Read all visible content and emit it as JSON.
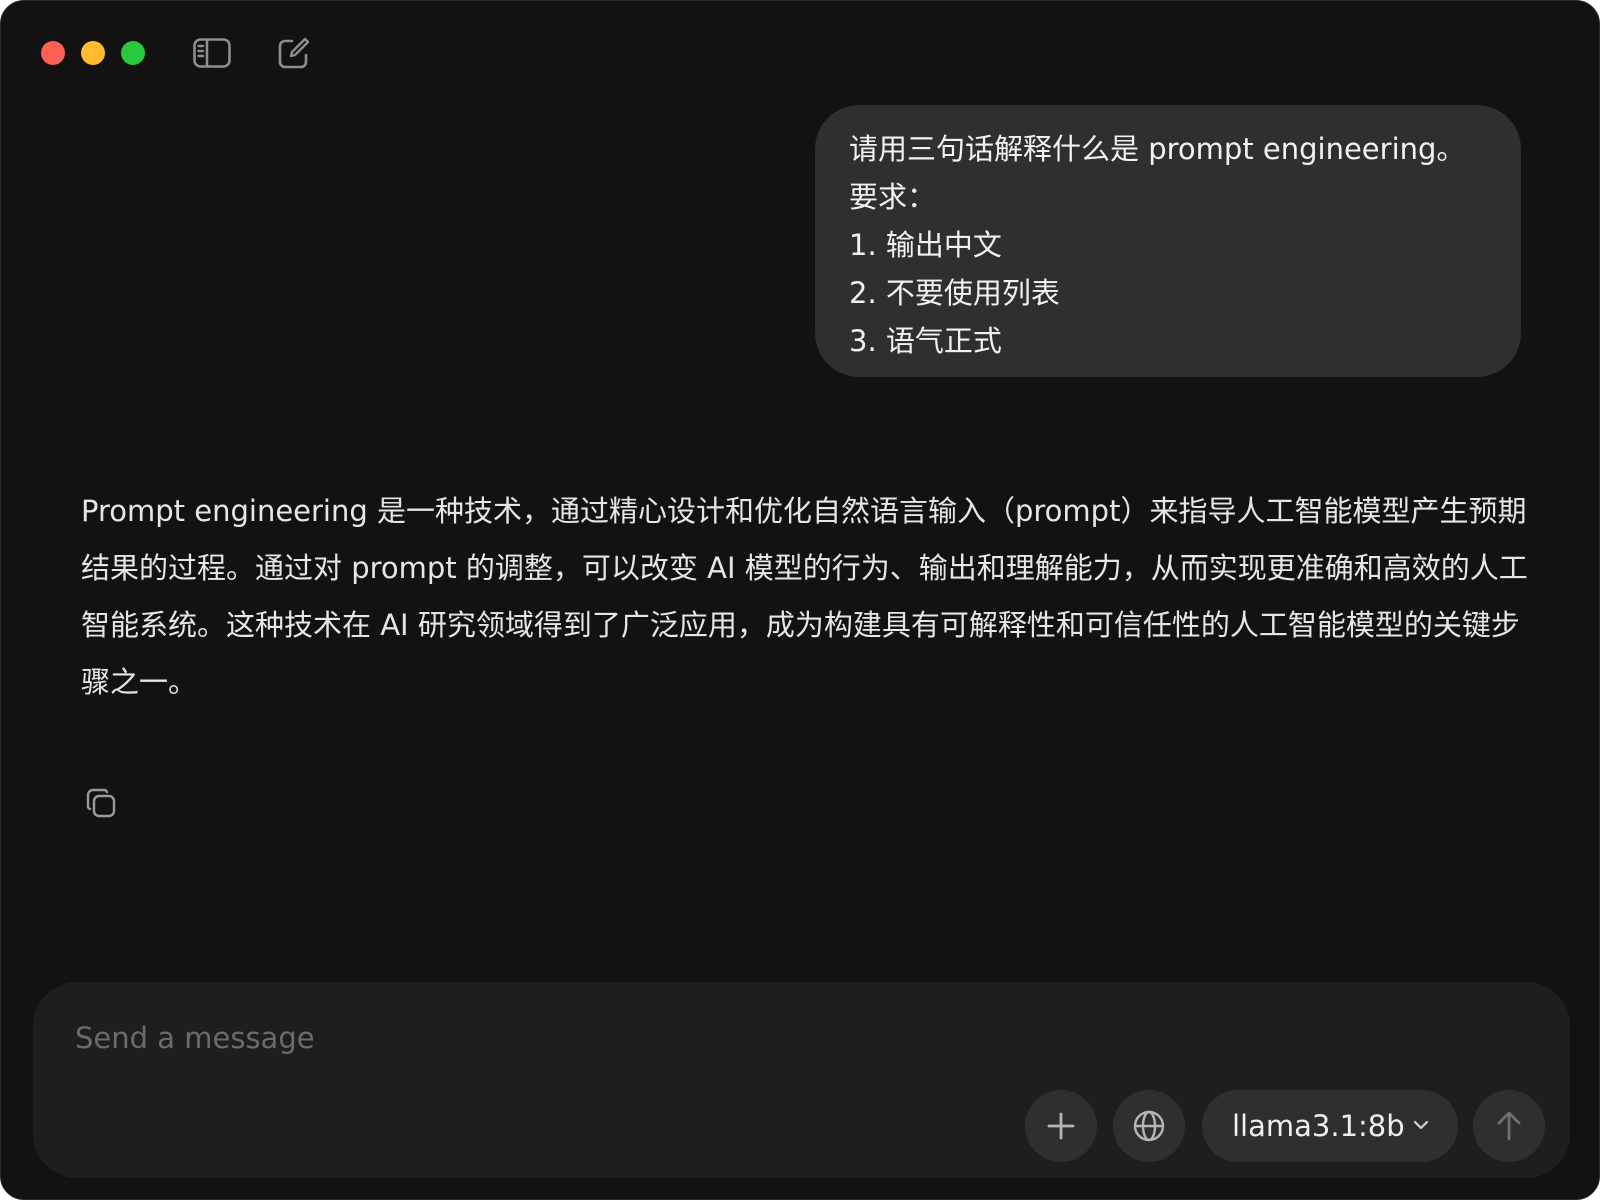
{
  "window": {
    "traffic_lights": [
      "close",
      "minimize",
      "maximize"
    ],
    "toolbar_icons": [
      "sidebar-icon",
      "new-chat-icon"
    ]
  },
  "conversation": {
    "user_message": {
      "lines": [
        "请用三句话解释什么是 prompt engineering。",
        "要求：",
        "1. 输出中文",
        "2. 不要使用列表",
        "3. 语气正式"
      ]
    },
    "assistant_message": {
      "text": "Prompt engineering 是一种技术，通过精心设计和优化自然语言输入（prompt）来指导人工智能模型产生预期结果的过程。通过对 prompt 的调整，可以改变 AI 模型的行为、输出和理解能力，从而实现更准确和高效的人工智能系统。这种技术在 AI 研究领域得到了广泛应用，成为构建具有可解释性和可信任性的人工智能模型的关键步骤之一。",
      "actions": [
        "copy-icon"
      ]
    }
  },
  "composer": {
    "placeholder": "Send a message",
    "value": "",
    "buttons": [
      "plus-icon",
      "globe-icon",
      "send-arrow-icon"
    ],
    "model": "llama3.1:8b"
  },
  "colors": {
    "window_bg": "#121212",
    "bubble_bg": "#2f2f2f",
    "composer_bg": "#1e1e1e",
    "close": "#fe5f57",
    "minimize": "#febc2e",
    "maximize": "#28c840"
  }
}
